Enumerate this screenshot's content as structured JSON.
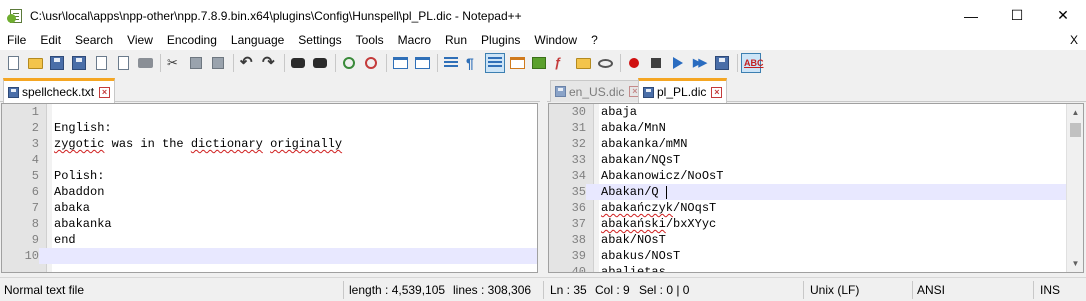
{
  "window": {
    "title": "C:\\usr\\local\\apps\\npp-other\\npp.7.8.9.bin.x64\\plugins\\Config\\Hunspell\\pl_PL.dic - Notepad++",
    "minimize": "—",
    "maximize": "☐",
    "close": "✕"
  },
  "menu": {
    "items": [
      "File",
      "Edit",
      "Search",
      "View",
      "Encoding",
      "Language",
      "Settings",
      "Tools",
      "Macro",
      "Run",
      "Plugins",
      "Window",
      "?"
    ],
    "close_doc": "X"
  },
  "toolbar": {
    "icons": [
      "new-file-icon",
      "open-file-icon",
      "save-icon",
      "save-all-icon",
      "close-icon",
      "close-all-icon",
      "print-icon",
      "cut-icon",
      "copy-icon",
      "paste-icon",
      "undo-icon",
      "redo-icon",
      "find-icon",
      "replace-icon",
      "zoom-in-icon",
      "zoom-out-icon",
      "sync-vertical-icon",
      "sync-horizontal-icon",
      "word-wrap-icon",
      "show-all-chars-icon",
      "indent-guide-icon",
      "doc-map-icon",
      "function-list-icon",
      "folder-workspace-icon",
      "monitoring-icon",
      "record-macro-icon",
      "stop-macro-icon",
      "play-macro-icon",
      "run-macro-multiple-icon",
      "save-macro-icon",
      "spell-check-icon"
    ]
  },
  "left_pane": {
    "tab": {
      "label": "spellcheck.txt"
    },
    "lines": [
      {
        "num": "1",
        "text": ""
      },
      {
        "num": "2",
        "text": "English:"
      },
      {
        "num": "3",
        "text": "zygotic was in the dictionary originally"
      },
      {
        "num": "4",
        "text": ""
      },
      {
        "num": "5",
        "text": "Polish:"
      },
      {
        "num": "6",
        "text": "Abaddon"
      },
      {
        "num": "7",
        "text": "abaka"
      },
      {
        "num": "8",
        "text": "abakanka"
      },
      {
        "num": "9",
        "text": "end"
      },
      {
        "num": "10",
        "text": ""
      }
    ]
  },
  "right_pane": {
    "tabs": [
      {
        "label": "en_US.dic"
      },
      {
        "label": "pl_PL.dic"
      }
    ],
    "lines": [
      {
        "num": "30",
        "text": "abaja"
      },
      {
        "num": "31",
        "text": "abaka/MnN"
      },
      {
        "num": "32",
        "text": "abakanka/mMN"
      },
      {
        "num": "33",
        "text": "abakan/NQsT"
      },
      {
        "num": "34",
        "text": "Abakanowicz/NoOsT"
      },
      {
        "num": "35",
        "text": "Abakan/Q"
      },
      {
        "num": "36",
        "text": "abakańczyk/NOqsT"
      },
      {
        "num": "37",
        "text": "abakański/bxXYyc"
      },
      {
        "num": "38",
        "text": "abak/NOsT"
      },
      {
        "num": "39",
        "text": "abakus/NOsT"
      },
      {
        "num": "40",
        "text": "abalietas"
      }
    ]
  },
  "status": {
    "file_type": "Normal text file",
    "length": "length : 4,539,105",
    "lines": "lines : 308,306",
    "ln": "Ln : 35",
    "col": "Col : 9",
    "sel": "Sel : 0 | 0",
    "eol": "Unix (LF)",
    "encoding": "ANSI",
    "ins": "INS"
  }
}
